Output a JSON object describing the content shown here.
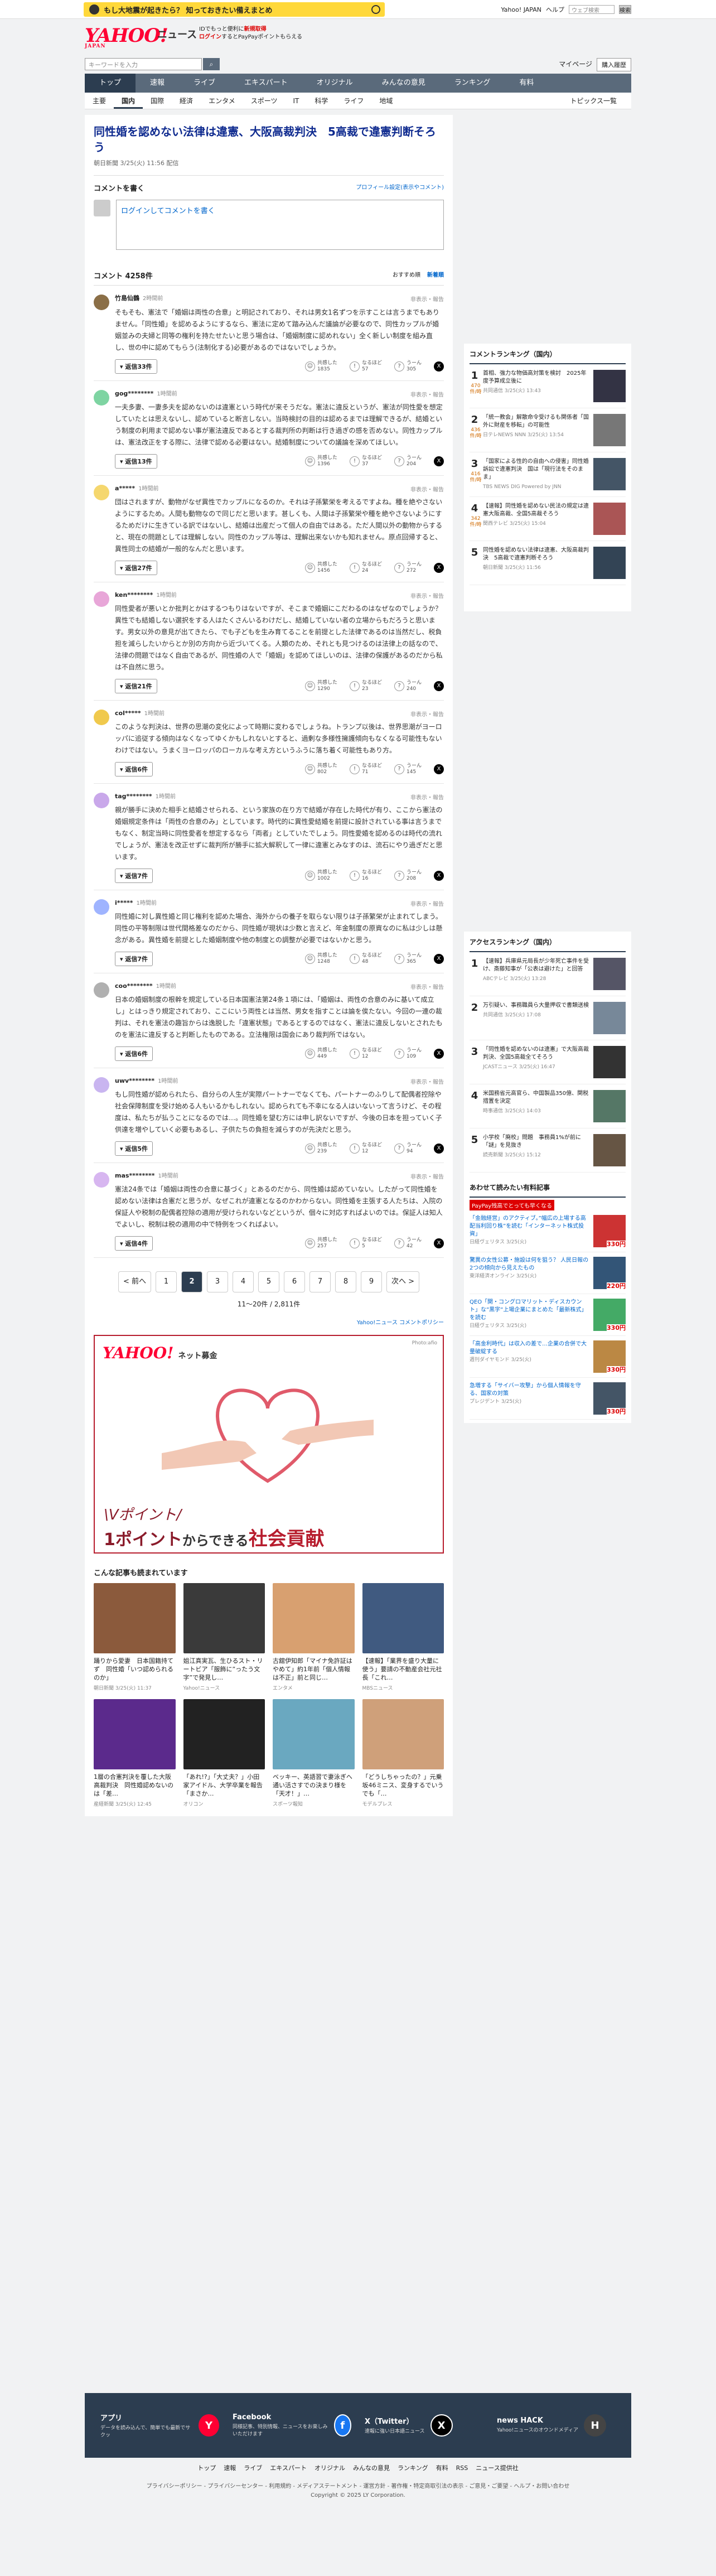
{
  "top": {
    "promo": "もし大地震が起きたら？ 知っておきたい備えまとめ",
    "links": [
      "Yahoo! JAPAN",
      "ヘルプ"
    ],
    "search_placeholder": "ウェブ検索",
    "search_btn": "検索"
  },
  "header": {
    "logo": "YAHOO!",
    "logo_sub": "JAPAN",
    "service": "ニュース",
    "line1": "IDでもっと便利に",
    "line1_red": "新規取得",
    "line2_red": "ログイン",
    "line2": "するとPayPayポイントもらえる",
    "search_placeholder": "キーワードを入力",
    "mypage": "マイページ",
    "buy": "購入履歴"
  },
  "gnav": [
    "トップ",
    "速報",
    "ライブ",
    "エキスパート",
    "オリジナル",
    "みんなの意見",
    "ランキング",
    "有料"
  ],
  "subnav": [
    "主要",
    "国内",
    "国際",
    "経済",
    "エンタメ",
    "スポーツ",
    "IT",
    "科学",
    "ライフ",
    "地域"
  ],
  "subnav_right": "トピックス一覧",
  "article": {
    "title": "同性婚を認めない法律は違憲、大阪高裁判決　5高裁で違憲判断そろう",
    "meta": "朝日新聞 3/25(火) 11:56 配信"
  },
  "comment_form": {
    "heading": "コメントを書く",
    "rule": "プロフィール設定(表示やコメント)",
    "login": "ログインしてコメントを書く"
  },
  "comments_header": {
    "count": "コメント 4258件",
    "sort_recommend": "おすすめ順",
    "sort_new": "新着順"
  },
  "comments": [
    {
      "user": "竹島仙鶴",
      "time": "2時間前",
      "color": "#8b6f47",
      "report": "非表示・報告",
      "text": "そもそも、憲法で「婚姻は両性の合意」と明記されており、それは男女1名ずつを示すことは言うまでもありません。「同性婚」を認めるようにするなら、憲法に定めて踏み込んだ議論が必要なので、同性カップルが婚姻並みの夫婦と同等の権利を持たせたいと思う場合は、「婚姻制度に認めれない」全く新しい制度を組み直し、世の中に認めてもらう(法制化する)必要があるのではないでしょうか。",
      "reply": "返信33件",
      "like": "1835",
      "neutral": "57",
      "dislike": "305"
    },
    {
      "user": "gog********",
      "time": "1時間前",
      "color": "#7ed4a2",
      "report": "非表示・報告",
      "text": "一夫多妻、一妻多夫を認めないのは違憲という時代が来そうだな。憲法に違反というが、憲法が同性愛を想定していたとは思えないし、認めていると断言しない。当時検討の目的は認めるまでは理解できるが、結婚という制度の利用まで認めない事が憲法違反であるとする裁判所の判断は行き過ぎの感を否めない。同性カップルは、憲法改正をする際に、法律で認める必要はない。結婚制度についての議論を深めてほしい。",
      "reply": "返信13件",
      "like": "1396",
      "neutral": "37",
      "dislike": "204"
    },
    {
      "user": "a*****",
      "time": "1時間前",
      "color": "#f5d76e",
      "report": "非表示・報告",
      "text": "団はされますが、動物がなぜ異性でカップルになるのか。それは子孫繁栄を考えるですよね。種を絶やさないようにするため。人間も動物なので同じだと思います。甚しくも、人間は子孫繁栄や種を絶やさないようにするためだけに生きている訳ではないし、結婚は出産だって個人の自由ではある。ただ人間以外の動物からすると、現在の問題としては理解しない。同性のカップル等は、理解出来ないかも知れません。原点回帰すると、異性同士の結婚が一般的なんだと思います。",
      "reply": "返信27件",
      "like": "1456",
      "neutral": "24",
      "dislike": "272"
    },
    {
      "user": "ken********",
      "time": "1時間前",
      "color": "#e8a6d8",
      "report": "非表示・報告",
      "text": "同性愛者が悪いとか批判とかはするつもりはないですが、そこまで婚姻にこだわるのはなぜなのでしょうか？異性でも結婚しない選択をする人はたくさんいるわけだし、結婚していない者の立場からもだろうと思います。男女以外の意見が出てきたら、でも子どもを生み育てることを前提とした法律であるのは当然だし、税負担を減らしたいからとか別の方向から近づいてくる。人類のため、それとも見つけるのは法律上の話なので、法律の問題ではなく自由であるが、同性婚の人で「婚姻」を認めてほしいのは、法律の保護があるのだから私は不自然に思う。",
      "reply": "返信21件",
      "like": "1290",
      "neutral": "23",
      "dislike": "240"
    },
    {
      "user": "col*****",
      "time": "1時間前",
      "color": "#f0c94d",
      "report": "非表示・報告",
      "text": "このような判決は、世界の思潮の変化によって時期に変わるでしょうね。トランプ以後は、世界思潮がヨーロッパに追従する傾向はなくなってゆくかもしれないとすると、過剰な多様性擁護傾向もなくなる可能性もないわけではない。うまくヨーロッパのローカルな考え方というふうに落ち着く可能性もあり方。",
      "reply": "返信6件",
      "like": "802",
      "neutral": "71",
      "dislike": "145"
    },
    {
      "user": "tag********",
      "time": "1時間前",
      "color": "#c9a8ea",
      "report": "非表示・報告",
      "text": "親が勝手に決めた相手と結婚させられる、という家族の在り方で結婚が存在した時代が有り、ここから憲法の婚姻規定条件は「両性の合意のみ」としています。時代的に異性愛結婚を前提に設計されている事は言うまでもなく、制定当時に同性愛者を想定するなら「両者」としていたでしょう。同性愛婚を認めるのは時代の流れでしょうが、憲法を改正せずに裁判所が勝手に拡大解釈して一律に違憲とみなすのは、流石にやり過ぎだと思います。",
      "reply": "返信7件",
      "like": "1002",
      "neutral": "16",
      "dislike": "208"
    },
    {
      "user": "i*****",
      "time": "1時間前",
      "color": "#9fb4ff",
      "report": "非表示・報告",
      "text": "同性婚に対し異性婚と同じ権利を認めた場合、海外からの養子を取らない限りは子孫繁栄が止まれてしまう。同性の平等制限は世代間格差なのだから、同性婚が現状は少数と言えど、年金制度の原資なのに私は少しは懸念がある。異性婚を前提とした婚姻制度や他の制度との調整が必要ではないかと思う。",
      "reply": "返信7件",
      "like": "1248",
      "neutral": "48",
      "dislike": "365"
    },
    {
      "user": "coo********",
      "time": "1時間前",
      "color": "#b0b0b0",
      "report": "非表示・報告",
      "text": "日本の婚姻制度の根幹を規定している日本国憲法第24条１項には、「婚姻は、両性の合意のみに基いて成立し」とはっきり規定されており、ここにいう両性とは当然、男女を指すことは論を俟たない。今回の一連の裁判は、それを憲法の趣旨からは逸脱した「違憲状態」であるとするのではなく、憲法に違反しないとされたものを憲法に違反すると判断したものである。立法権限は国会にあり裁判所ではない。",
      "reply": "返信6件",
      "like": "449",
      "neutral": "12",
      "dislike": "109"
    },
    {
      "user": "uwv********",
      "time": "1時間前",
      "color": "#c9b5f0",
      "report": "非表示・報告",
      "text": "もし同性婚が認められたら、自分らの人生が実際パートナーでなくても、パートナーのふりして配偶者控除や社会保障制度を受け始める人もいるかもしれない。認められても不幸になる人はいないって言うけど、その程度は、私たちが払うことになるのでは…。同性婚を望む方には申し訳ないですが、今後の日本を担っていく子供達を増やしていく必要もあるし、子供たちの負担を減らすのが先決だと思う。",
      "reply": "返信5件",
      "like": "239",
      "neutral": "12",
      "dislike": "94"
    },
    {
      "user": "mas********",
      "time": "1時間前",
      "color": "#d7b6f0",
      "report": "非表示・報告",
      "text": "憲法24条では「婚姻は両性の合意に基づく」とあるのだから、同性婚は認めていない。したがって同性婚を認めない法律は合憲だと思うが、なぜこれが違憲となるのかわからない。同性婚を主張する人たちは、入院の保証人や税制の配偶者控除の適用が受けられないなどというが、個々に対応すればよいのでは。保証人は知人でよいし、税制は税の適用の中で特例をつくればよい。",
      "reply": "返信4件",
      "like": "257",
      "neutral": "5",
      "dislike": "42"
    }
  ],
  "pager": {
    "prev": "< 前へ",
    "pages": [
      "1",
      "2",
      "3",
      "4",
      "5",
      "6",
      "7",
      "8",
      "9"
    ],
    "current": "2",
    "next": "次へ >",
    "info": "11〜20件 / 2,811件"
  },
  "policy": "Yahoo!ニュース コメントポリシー",
  "ad": {
    "logo": "YAHOO!",
    "logo_sub": "ネット募金",
    "photo": "Photo:afio",
    "line1": "\\Vポイント/",
    "line2_a": "1ポイント",
    "line2_b": "からできる",
    "line2_c": "社会貢献"
  },
  "related": {
    "heading": "こんな記事も読まれています",
    "items": [
      {
        "title": "踊りから愛妻　日本国籍持てず　同性婚「いつ認められるのか」",
        "src": "朝日新聞 3/25(火) 11:37",
        "color": "#8b5a3c"
      },
      {
        "title": "姐江真実瓦、生ひるスト・リートビア「服飾に”ったう文字”で発見し…",
        "src": "Yahoo!ニュース",
        "color": "#3a3a3a"
      },
      {
        "title": "古舘伊知郎「マイナ免許証はやめて」約1年前「個人情報は不正」前と同じ…",
        "src": "エンタメ",
        "color": "#d8a070"
      },
      {
        "title": "【速報】「業界を盛り大量に使う」要請の不動産会社元社長「これ…",
        "src": "MBSニュース",
        "color": "#405a80"
      },
      {
        "title": "1層の合憲判決を覆した大阪高裁判決　同性婚認めないのは「差…",
        "src": "産経新聞 3/25(火) 12:45",
        "color": "#5b2a8c"
      },
      {
        "title": "「あれ!?」「大丈夫？」小田家アイドル、大学卒業を報告「まさか…",
        "src": "オリコン",
        "color": "#222"
      },
      {
        "title": "ベッキー、英語習で妻泳ぎへ通い活さすでの決まり様を「天才！」…",
        "src": "スポーツ報知",
        "color": "#6aa8c0"
      },
      {
        "title": "「どうしちゃったの？」元乗坂46ミニス、変身するでいうでも「…",
        "src": "モデルプレス",
        "color": "#cfa07a"
      }
    ]
  },
  "side_ranking": {
    "heading": "コメントランキング（国内）",
    "items": [
      {
        "no": "1",
        "count": "470",
        "unit": "件/時",
        "title": "首相、強力な物価高対策を検討　2025年度予算成立後に",
        "src": "共同通信 3/25(火) 13:43",
        "color": "#334"
      },
      {
        "no": "2",
        "count": "436",
        "unit": "件/時",
        "title": "「統一教会」解散命令受けるも関係者「国外に財産を移転」の可能性",
        "src": "日テレNEWS NNN 3/25(火) 13:54",
        "color": "#777"
      },
      {
        "no": "3",
        "count": "416",
        "unit": "件/時",
        "title": "「国家による性的の自由への侵害」同性婚訴訟で違憲判決　国は「現行法をそのまま」",
        "src": "TBS NEWS DIG Powered by JNN",
        "color": "#456"
      },
      {
        "no": "4",
        "count": "342",
        "unit": "件/時",
        "title": "【速報】同性婚を認めない民法の規定は違憲大阪高裁、全国5高裁そろう",
        "src": "関西テレビ 3/25(火) 15:04",
        "color": "#a55"
      },
      {
        "no": "5",
        "count": "",
        "unit": "",
        "title": "同性婚を認めない法律は違憲、大阪高裁判決　5高裁で違憲判断そろう",
        "src": "朝日新聞 3/25(火) 11:56",
        "color": "#345"
      }
    ]
  },
  "side_access": {
    "heading": "アクセスランキング（国内）",
    "items": [
      {
        "no": "1",
        "title": "【速報】兵庫県元局長が少年死亡事件を受け、斎藤知事が「公表は避けた」と回答",
        "src": "ABCテレビ 3/25(火) 13:28",
        "color": "#556"
      },
      {
        "no": "2",
        "title": "万引疑い、事務職員ら大量押収で書類送検",
        "src": "共同通信 3/25(火) 17:08",
        "color": "#789"
      },
      {
        "no": "3",
        "title": "「同性婚を認めないのは違憲」で大阪高裁判決、全国5高裁全てそろう",
        "src": "JCASTニュース 3/25(火) 16:47",
        "color": "#333"
      },
      {
        "no": "4",
        "title": "米国務省元高官ら、中国製品350億、関税措置を決定",
        "src": "時事通信 3/25(火) 14:03",
        "color": "#576"
      },
      {
        "no": "5",
        "title": "小学校「廃校」問題　事務員1%が前に「謎」を見抜き",
        "src": "読売新聞 3/25(火) 15:12",
        "color": "#654"
      }
    ]
  },
  "side_shop": {
    "heading": "あわせて読みたい有料記事",
    "paypay": "PayPay残高でとっても早くなる",
    "items": [
      {
        "title": "「金融経営」のアクティブ。”幅広の上場する高配当利回り株”を読む「インターネット株式投資」",
        "src": "日経ヴェリタス 3/25(火)",
        "price": "330円",
        "color": "#c33"
      },
      {
        "title": "驚異の女性公募・施設は何を狙う？ 人民日報の2つの傾向から見えたもの",
        "src": "東洋経済オンライン 3/25(火)",
        "price": "220円",
        "color": "#357"
      },
      {
        "title": "QEO「関・コングロマリット・ディスカウント」な”黒字”上場企業にまとめた「最新株式」を読む",
        "src": "日経ヴェリタス 3/25(火)",
        "price": "330円",
        "color": "#4a6"
      },
      {
        "title": "「高金利時代」は収入の差で…企業の合併で大量破綻する",
        "src": "週刊ダイヤモンド 3/25(火)",
        "price": "330円",
        "color": "#b84"
      },
      {
        "title": "急増する「サイバー攻撃」から個人情報を守る、国家の対策",
        "src": "プレジデント 3/25(火)",
        "price": "330円",
        "color": "#456"
      }
    ]
  },
  "footer": {
    "cols": [
      {
        "title": "アプリ",
        "desc": "データを読み込んで、簡単でも最新でサクッ",
        "icon": "Y",
        "color": "#ff0033"
      },
      {
        "title": "Facebook",
        "desc": "同様記事、特別情報、ニュースをお楽しみいただけます",
        "icon": "f",
        "color": "#1877f2"
      },
      {
        "title": "X（Twitter）",
        "desc": "速報に強い日本語ニュース",
        "icon": "X",
        "color": "#000"
      },
      {
        "title": "news HACK",
        "desc": "Yahoo!ニュースのオウンドメディア",
        "icon": "H",
        "color": "#444"
      }
    ],
    "nav": [
      "トップ",
      "速報",
      "ライブ",
      "エキスパート",
      "オリジナル",
      "みんなの意見",
      "ランキング",
      "有料",
      "RSS",
      "ニュース提供社"
    ],
    "links": "プライバシーポリシー - プライバシーセンター - 利用規約 - メディアステートメント - 運営方針 - 著作権・特定商取引法の表示 - ご意見・ご要望 - ヘルプ・お問い合わせ",
    "copyright": "Copyright © 2025 LY Corporation."
  }
}
